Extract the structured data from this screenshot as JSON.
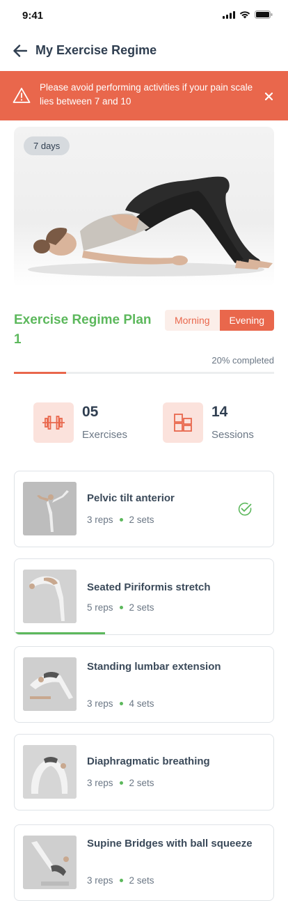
{
  "status_bar": {
    "time": "9:41"
  },
  "header": {
    "title": "My Exercise Regime"
  },
  "alert": {
    "message": "Please avoid performing activities if your pain scale lies between 7 and 10"
  },
  "hero": {
    "days_badge": "7 days"
  },
  "plan": {
    "title": "Exercise Regime Plan 1",
    "toggle": {
      "options": [
        "Morning",
        "Evening"
      ],
      "selected": "Evening"
    },
    "completed_label": "20% completed",
    "progress": 0.2
  },
  "stats": {
    "exercises": {
      "value": "05",
      "label": "Exercises"
    },
    "sessions": {
      "value": "14",
      "label": "Sessions"
    }
  },
  "exercises": [
    {
      "name": "Pelvic tilt anterior",
      "reps": "3 reps",
      "sets": "2 sets",
      "completed": true,
      "progress": 0
    },
    {
      "name": "Seated Piriformis stretch",
      "reps": "5 reps",
      "sets": "2 sets",
      "completed": false,
      "progress": 0.35
    },
    {
      "name": "Standing lumbar extension",
      "reps": "3 reps",
      "sets": "4 sets",
      "completed": false,
      "progress": 0
    },
    {
      "name": "Diaphragmatic breathing",
      "reps": "3 reps",
      "sets": "2 sets",
      "completed": false,
      "progress": 0
    },
    {
      "name": "Supine Bridges with ball squeeze",
      "reps": "3 reps",
      "sets": "2 sets",
      "completed": false,
      "progress": 0
    }
  ],
  "colors": {
    "accent": "#e9674c",
    "success": "#5cb85c",
    "text": "#2f3e50"
  }
}
